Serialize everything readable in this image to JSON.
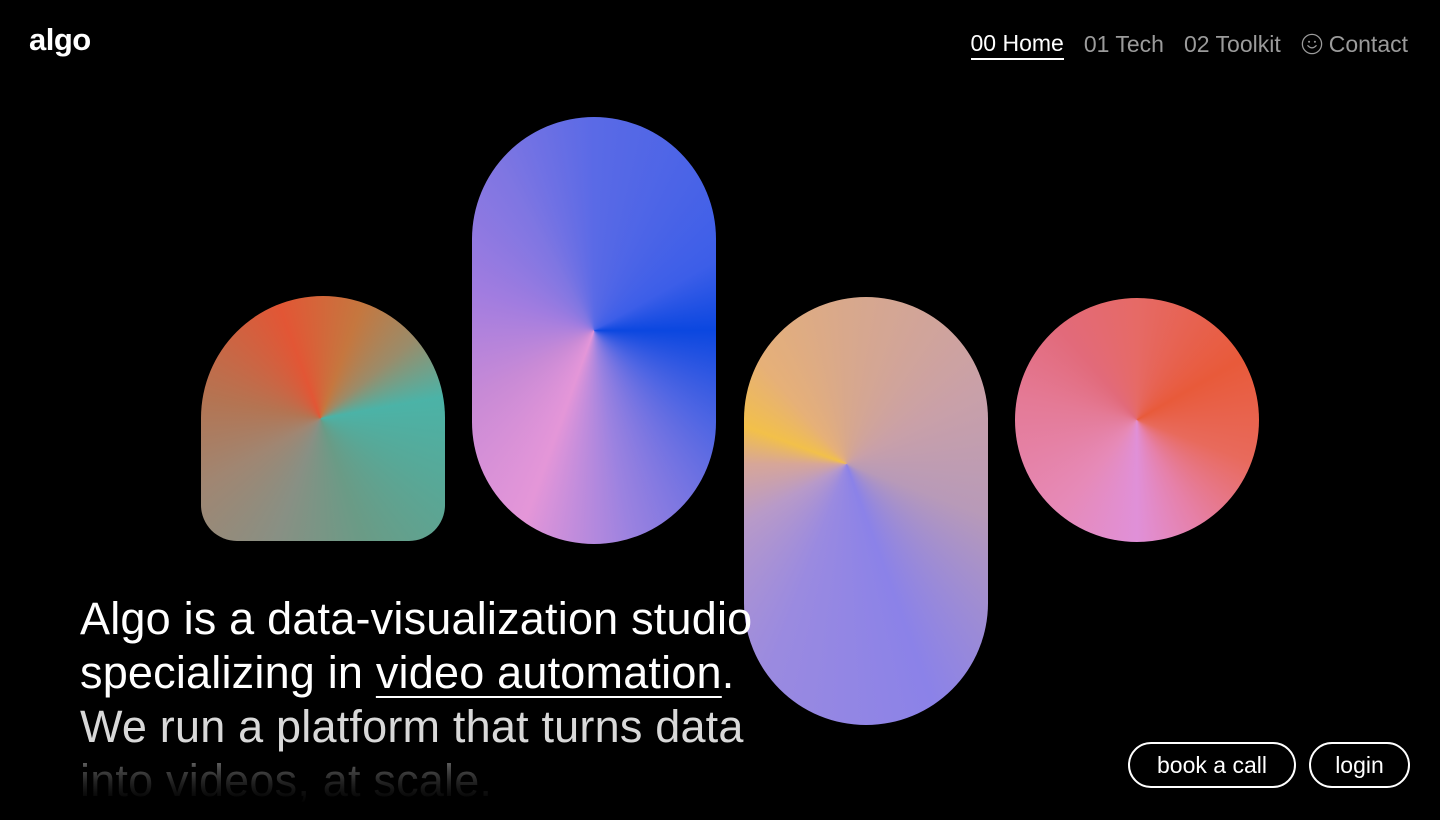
{
  "brand": {
    "logo_text": "algo"
  },
  "nav": {
    "items": [
      {
        "label": "00 Home",
        "active": true
      },
      {
        "label": "01 Tech",
        "active": false
      },
      {
        "label": "02 Toolkit",
        "active": false
      }
    ],
    "contact": {
      "label": "Contact",
      "icon": "smiley-icon"
    }
  },
  "hero": {
    "line1": "Algo is a data-visualization studio",
    "line2_prefix": "specializing in ",
    "line2_link": "video automation",
    "line2_suffix": ".",
    "line3": "We run a platform that turns data",
    "line4": "into videos, at scale."
  },
  "actions": {
    "book_call": "book a call",
    "login": "login"
  },
  "colors": {
    "background": "#000000",
    "text": "#ffffff",
    "nav_inactive": "#9b9b9b"
  }
}
